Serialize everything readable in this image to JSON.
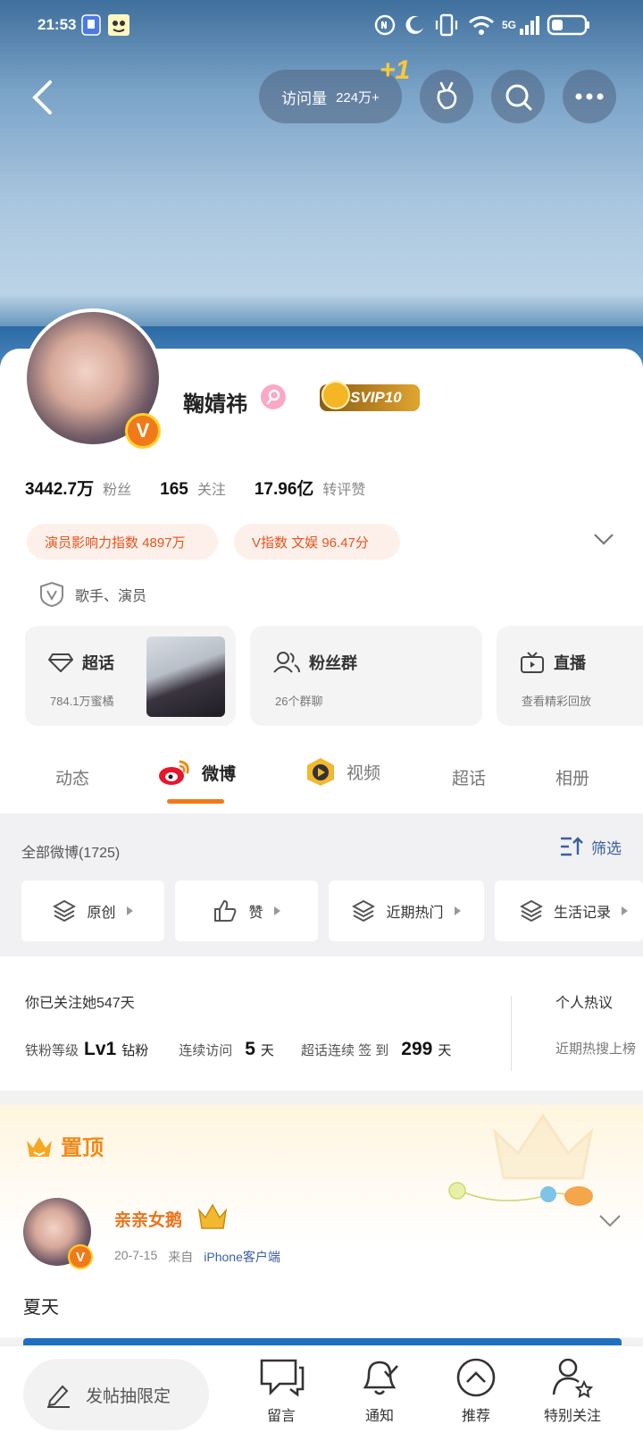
{
  "status_bar": {
    "time": "21:53",
    "network": "5G",
    "icons": [
      "app-notification-icon",
      "app-sticker-icon",
      "nfc-icon",
      "moon-icon",
      "vibrate-icon",
      "wifi-icon",
      "signal-icon",
      "battery-icon"
    ]
  },
  "header": {
    "visits_label": "访问量",
    "visits_value": "224万+",
    "plus_one": "+1",
    "icons": [
      "back-icon",
      "radish-icon",
      "search-icon",
      "more-icon"
    ]
  },
  "profile": {
    "name": "鞠婧祎",
    "svip": "SVIP10",
    "verified_badge": "V",
    "stats": [
      {
        "value": "3442.7万",
        "label": "粉丝"
      },
      {
        "value": "165",
        "label": "关注"
      },
      {
        "value": "17.96亿",
        "label": "转评赞"
      }
    ],
    "tags": [
      "演员影响力指数 4897万",
      "V指数  文娱  96.47分"
    ],
    "verification": "歌手、演员",
    "features": [
      {
        "title": "超话",
        "sub": "784.1万蜜橘"
      },
      {
        "title": "粉丝群",
        "sub": "26个群聊"
      },
      {
        "title": "直播",
        "sub": "查看精彩回放"
      }
    ]
  },
  "tabs": [
    {
      "label": "动态"
    },
    {
      "label": "微博",
      "active": true
    },
    {
      "label": "视频"
    },
    {
      "label": "超话"
    },
    {
      "label": "相册"
    }
  ],
  "feed": {
    "all_label": "全部微博(1725)",
    "filter_label": "筛选",
    "chips": [
      "原创",
      "赞",
      "近期热门",
      "生活记录"
    ]
  },
  "follow_info": {
    "since": "你已关注她547天",
    "fan_level_label": "铁粉等级",
    "fan_level_value": "Lv1",
    "fan_level_suffix": "钻粉",
    "visit_label": "连续访问",
    "visit_value": "5",
    "visit_unit": "天",
    "checkin_label": "超话连续 签 到",
    "checkin_value": "299",
    "checkin_unit": "天",
    "hot_title": "个人热议",
    "hot_sub": "近期热搜上榜"
  },
  "pinned": {
    "title": "置顶",
    "author": "亲亲女鹅",
    "date": "20-7-15",
    "from_label": "来自",
    "source": "iPhone客户端",
    "text": "夏天"
  },
  "bottom_bar": {
    "compose_label": "发帖抽限定",
    "items": [
      "留言",
      "通知",
      "推荐",
      "特别关注"
    ]
  },
  "colors": {
    "accent": "#f07a1a",
    "link": "#3a5fa0",
    "tag_bg": "#fdf0ea",
    "tag_text": "#e8541e"
  }
}
